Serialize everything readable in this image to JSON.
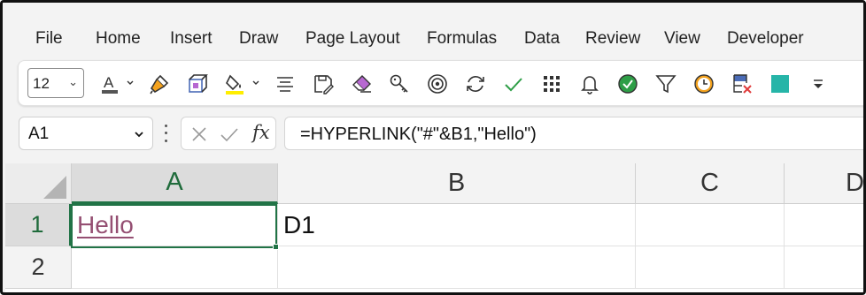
{
  "menu": [
    "File",
    "Home",
    "Insert",
    "Draw",
    "Page Layout",
    "Formulas",
    "Data",
    "Review",
    "View",
    "Developer"
  ],
  "toolbar": {
    "font_size": "12",
    "buttons": [
      "font-color",
      "format-painter",
      "3d-box",
      "fill-color",
      "align",
      "save-as",
      "eraser",
      "key",
      "target",
      "refresh",
      "check",
      "grid",
      "bell",
      "check-circle",
      "filter",
      "clock",
      "delete-sheet",
      "fill-square",
      "customize"
    ],
    "colors": {
      "font_color_bar": "#555555",
      "fill_color_bar": "#ffee00",
      "teal": "#26b5a8",
      "orange": "#f4a21d",
      "green": "#2e9e47"
    }
  },
  "name_box": {
    "value": "A1"
  },
  "formula_bar": {
    "fx": "fx",
    "value": "=HYPERLINK(\"#\"&B1,\"Hello\")"
  },
  "grid": {
    "columns": [
      "A",
      "B",
      "C",
      "D"
    ],
    "rows": [
      "1",
      "2"
    ],
    "cells": {
      "A1": "Hello",
      "B1": "D1"
    }
  }
}
